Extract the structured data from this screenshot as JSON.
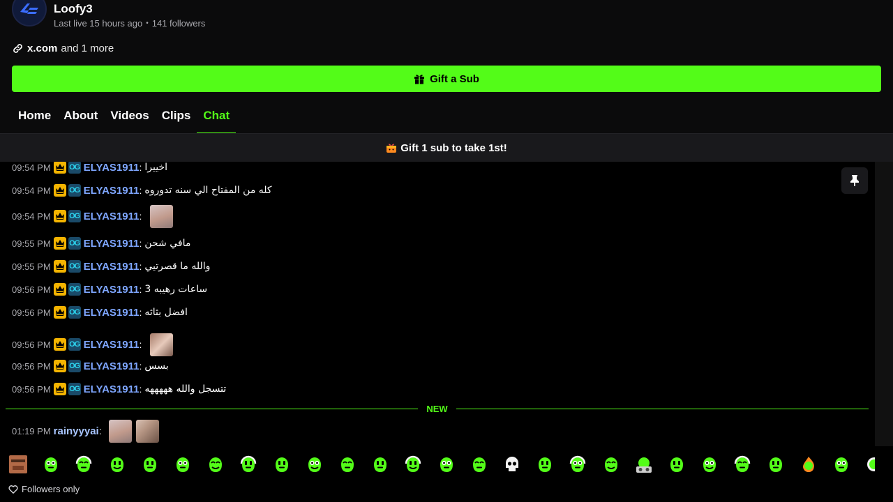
{
  "channel": {
    "name": "Loofy3",
    "last_live": "Last live 15 hours ago",
    "separator": "•",
    "followers": "141 followers",
    "link_main": "x.com",
    "link_more": "and 1 more"
  },
  "gift_button": {
    "label": "Gift a Sub"
  },
  "tabs": [
    {
      "label": "Home"
    },
    {
      "label": "About"
    },
    {
      "label": "Videos"
    },
    {
      "label": "Clips"
    },
    {
      "label": "Chat",
      "active": true
    }
  ],
  "banner": {
    "text": "Gift 1 sub to take 1st!"
  },
  "chat": {
    "messages": [
      {
        "time": "09:54 PM",
        "user": "ELYAS1911",
        "text": "اخييرا"
      },
      {
        "time": "09:54 PM",
        "user": "ELYAS1911",
        "text": "كله من المفتاح الي سنه تدوروه"
      },
      {
        "time": "09:54 PM",
        "user": "ELYAS1911",
        "text": "",
        "emote": "baby-emote"
      },
      {
        "time": "09:55 PM",
        "user": "ELYAS1911",
        "text": "مافي شحن"
      },
      {
        "time": "09:55 PM",
        "user": "ELYAS1911",
        "text": "والله ما قصرتيي"
      },
      {
        "time": "09:56 PM",
        "user": "ELYAS1911",
        "text": "ساعات رهيبه 3"
      },
      {
        "time": "09:56 PM",
        "user": "ELYAS1911",
        "text": "افضل بثاثه"
      },
      {
        "time": "09:56 PM",
        "user": "ELYAS1911",
        "text": "",
        "emote": "baby-emote"
      },
      {
        "time": "09:56 PM",
        "user": "ELYAS1911",
        "text": "بسس"
      },
      {
        "time": "09:56 PM",
        "user": "ELYAS1911",
        "text": "تتسجل والله هههههه"
      }
    ],
    "new_label": "NEW",
    "new_messages": [
      {
        "time": "01:19 PM",
        "user": "rainyyyai",
        "emotes": [
          "baby-emote",
          "baby-emote"
        ]
      }
    ],
    "badge_og_text": "OG"
  },
  "emote_bar": {
    "emotes": [
      "streamer-face-emote",
      "kick-green-emote",
      "angry-green-emote",
      "star-eyes-emote",
      "kick-laugh-emote",
      "glasses-emote",
      "smile-emote",
      "happy-emote",
      "small-emote",
      "grin-emote",
      "heart-eyes-emote",
      "sad-emote",
      "headphones-emote",
      "wink-emote",
      "shock-emote",
      "skull-emote",
      "devil-emote",
      "crying-emote",
      "cool-emote",
      "dj-emote",
      "smirk-emote",
      "nerd-emote",
      "gamer-emote",
      "sweat-emote",
      "fire-emote",
      "yell-emote",
      "partial-emote"
    ]
  },
  "footer": {
    "text": "Followers only"
  },
  "colors": {
    "accent": "#53fc18",
    "username": "#7ea6ff",
    "background": "#000000"
  }
}
